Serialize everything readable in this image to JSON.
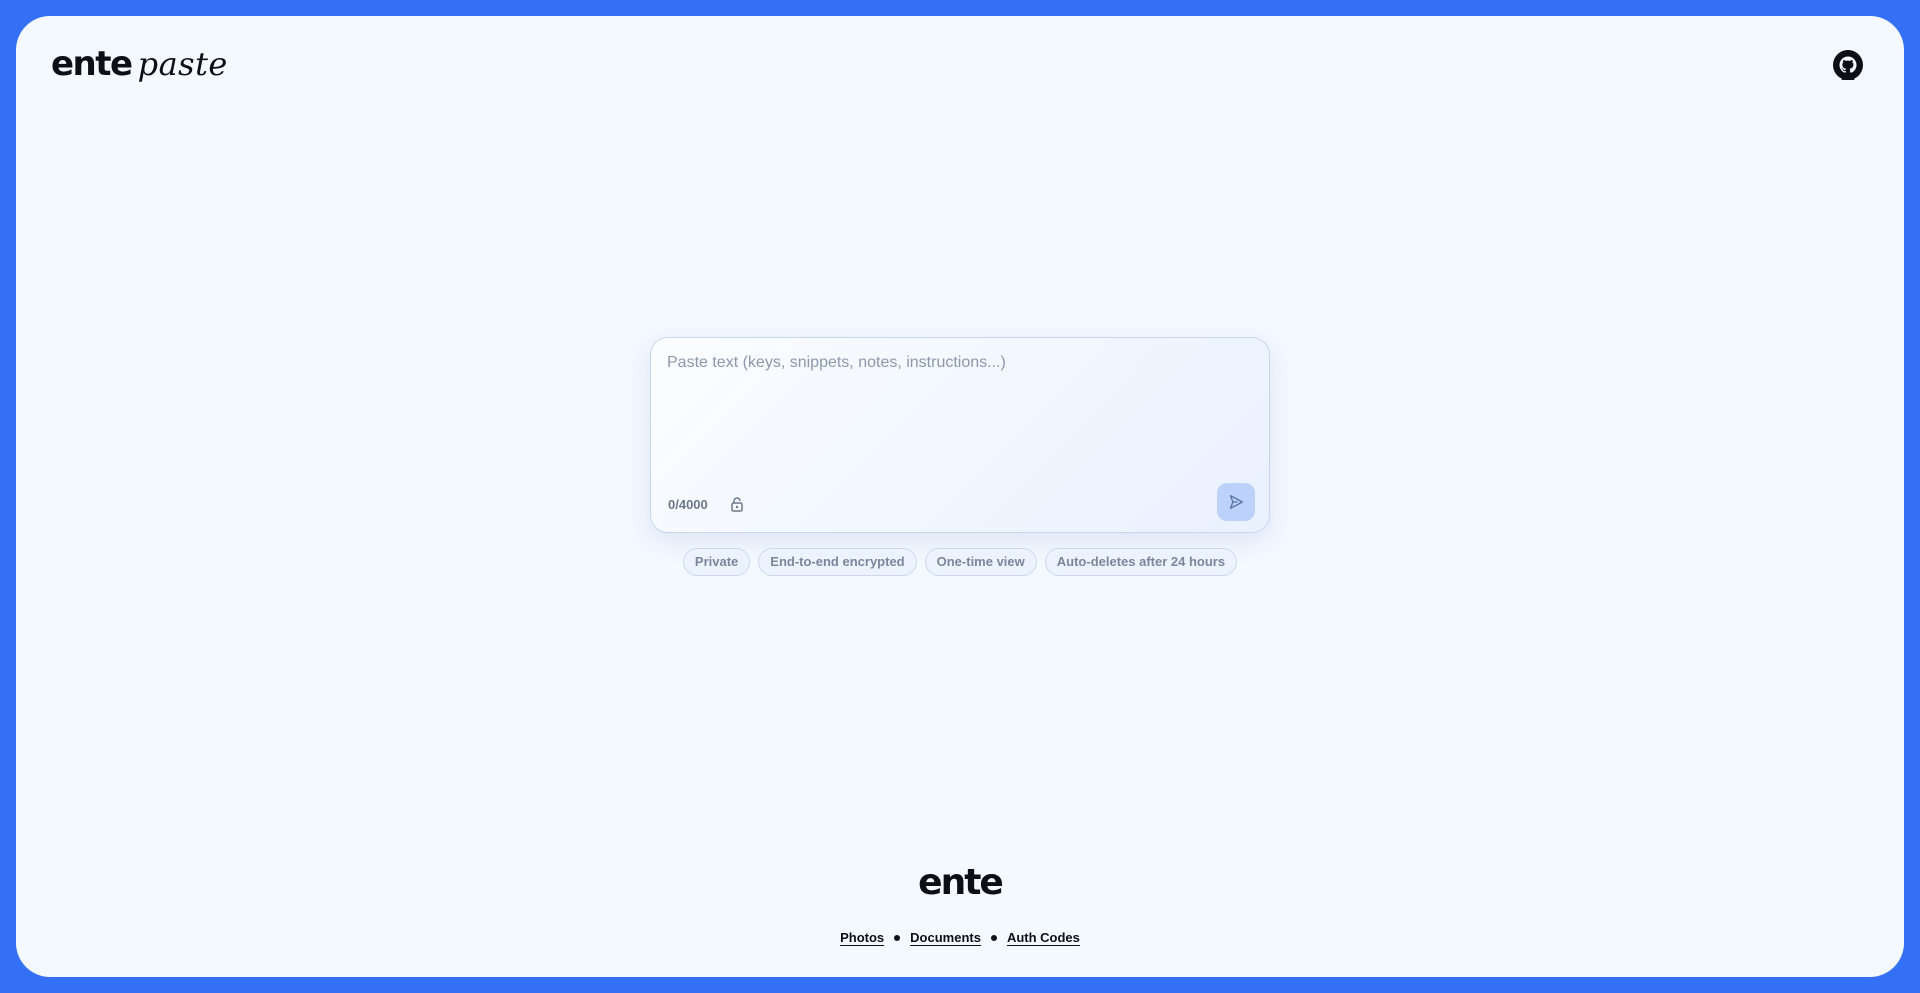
{
  "header": {
    "logo_primary": "ente",
    "logo_secondary": "paste",
    "github_icon": "github-icon"
  },
  "paste": {
    "placeholder": "Paste text (keys, snippets, notes, instructions...)",
    "value": "",
    "counter": "0/4000",
    "lock_icon": "lock-icon",
    "send_icon": "send-icon"
  },
  "features": [
    "Private",
    "End-to-end encrypted",
    "One-time view",
    "Auto-deletes after 24 hours"
  ],
  "footer": {
    "logo": "ente",
    "links": [
      "Photos",
      "Documents",
      "Auth Codes"
    ]
  },
  "colors": {
    "background": "#3370f6",
    "panel": "#f4f8ff",
    "send_button": "#bcd2fb",
    "pill_bg": "#edf3fe",
    "pill_text": "#7a879b"
  }
}
